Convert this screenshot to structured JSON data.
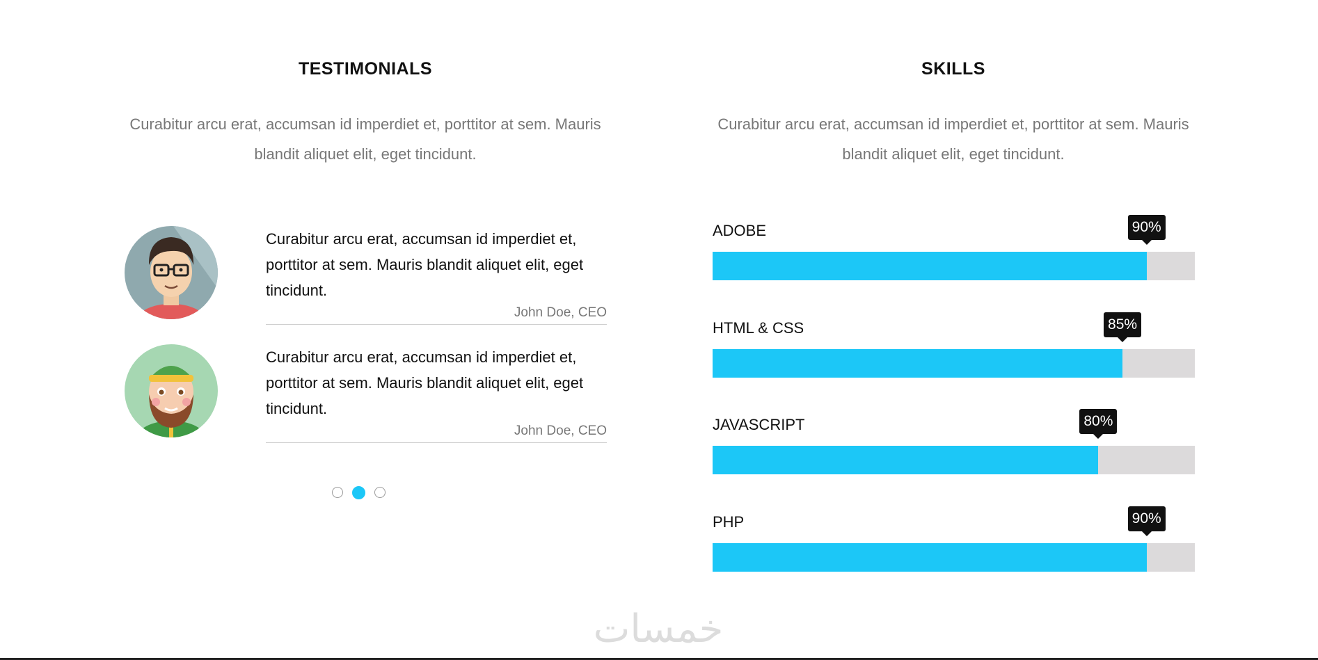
{
  "testimonials": {
    "title": "TESTIMONIALS",
    "intro": "Curabitur arcu erat, accumsan id imperdiet et, porttitor at sem. Mauris blandit aliquet elit, eget tincidunt.",
    "items": [
      {
        "avatar_icon": "man-with-glasses-avatar-icon",
        "text": "Curabitur arcu erat, accumsan id imperdiet et, porttitor at sem. Mauris blandit aliquet elit, eget tincidunt.",
        "author": "John Doe, CEO"
      },
      {
        "avatar_icon": "bearded-man-with-cap-avatar-icon",
        "text": "Curabitur arcu erat, accumsan id imperdiet et, porttitor at sem. Mauris blandit aliquet elit, eget tincidunt.",
        "author": "John Doe, CEO"
      }
    ],
    "pagination": {
      "count": 3,
      "active": 2
    }
  },
  "skills": {
    "title": "SKILLS",
    "intro": "Curabitur arcu erat, accumsan id imperdiet et, porttitor at sem. Mauris blandit aliquet elit, eget tincidunt.",
    "items": [
      {
        "label": "ADOBE",
        "percent": 90,
        "percent_label": "90%"
      },
      {
        "label": "HTML & CSS",
        "percent": 85,
        "percent_label": "85%"
      },
      {
        "label": "JAVASCRIPT",
        "percent": 80,
        "percent_label": "80%"
      },
      {
        "label": "PHP",
        "percent": 90,
        "percent_label": "90%"
      }
    ]
  },
  "watermark": "خمسات",
  "colors": {
    "accent": "#1cc7f7",
    "track": "#dcdadb",
    "tooltip": "#111111",
    "muted_text": "#777777"
  }
}
